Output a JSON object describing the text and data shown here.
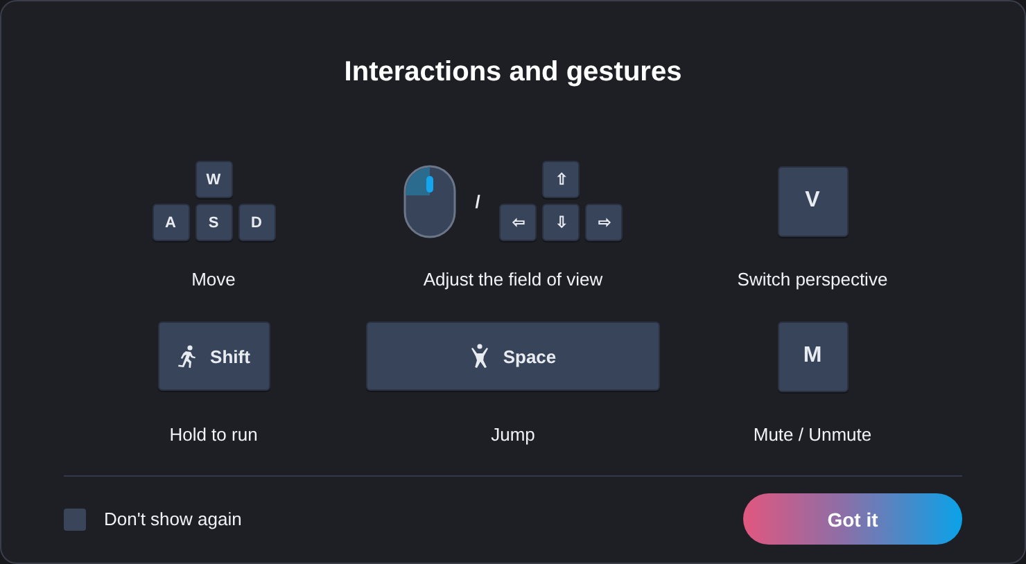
{
  "title": "Interactions and gestures",
  "controls": [
    {
      "kind": "wasd",
      "keys": [
        "W",
        "A",
        "S",
        "D"
      ],
      "label": "Move"
    },
    {
      "kind": "mouse_arrows",
      "separator": "/",
      "keys": [
        "⇧",
        "⇦",
        "⇩",
        "⇨"
      ],
      "label": "Adjust the field of view"
    },
    {
      "kind": "key",
      "key": "V",
      "label": "Switch perspective"
    },
    {
      "kind": "run_key",
      "key": "Shift",
      "label": "Hold to run"
    },
    {
      "kind": "jump_key",
      "key": "Space",
      "label": "Jump"
    },
    {
      "kind": "key",
      "key": "M",
      "label": "Mute / Unmute"
    }
  ],
  "dont_show_again": {
    "label": "Don't show again",
    "checked": false
  },
  "confirm_button": "Got it"
}
